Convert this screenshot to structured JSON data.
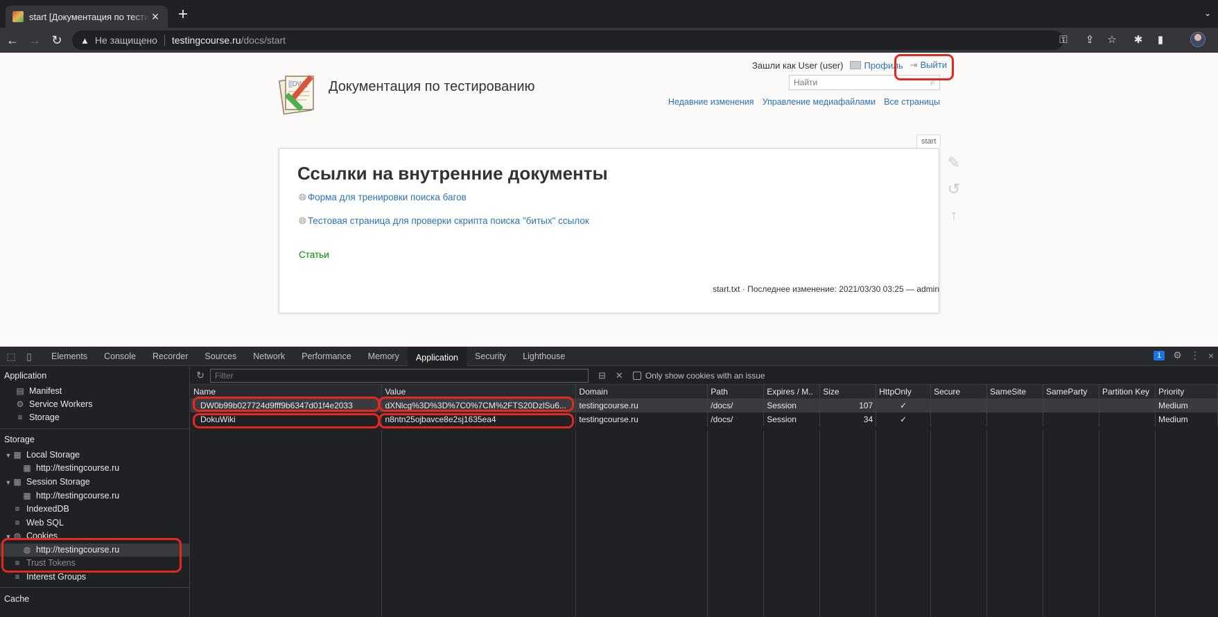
{
  "browser": {
    "tab_title": "start [Документация по тестированию]",
    "address": {
      "warning": "Не защищено",
      "host": "testingcourse.ru",
      "path": "/docs/start"
    }
  },
  "page": {
    "site_title": "Документация по тестированию",
    "logged_in_as": "Зашли как User (user)",
    "profile_link": "Профиль",
    "logout_link": "Выйти",
    "search_placeholder": "Найти",
    "links": [
      "Недавние изменения",
      "Управление медиафайлами",
      "Все страницы"
    ],
    "page_tab": "start",
    "heading": "Ссылки на внутренние документы",
    "doc_links": [
      "Форма для тренировки поиска багов",
      "Тестовая страница для проверки скрипта поиска \"битых\" ссылок"
    ],
    "articles": "Статьи",
    "page_info": "start.txt · Последнее изменение: 2021/03/30 03:25 — admin"
  },
  "devtools": {
    "tabs": [
      "Elements",
      "Console",
      "Recorder",
      "Sources",
      "Network",
      "Performance",
      "Memory",
      "Application",
      "Security",
      "Lighthouse"
    ],
    "active_tab": "Application",
    "issues_count": "1",
    "sidebar": {
      "application_head": "Application",
      "application_items": [
        "Manifest",
        "Service Workers",
        "Storage"
      ],
      "storage_head": "Storage",
      "local_storage": "Local Storage",
      "local_storage_origin": "http://testingcourse.ru",
      "session_storage": "Session Storage",
      "session_storage_origin": "http://testingcourse.ru",
      "indexeddb": "IndexedDB",
      "websql": "Web SQL",
      "cookies": "Cookies",
      "cookies_origin": "http://testingcourse.ru",
      "trust_tokens": "Trust Tokens",
      "interest_groups": "Interest Groups",
      "cache_head": "Cache"
    },
    "filter_placeholder": "Filter",
    "only_issue_label": "Only show cookies with an issue",
    "columns": [
      "Name",
      "Value",
      "Domain",
      "Path",
      "Expires / M..",
      "Size",
      "HttpOnly",
      "Secure",
      "SameSite",
      "SameParty",
      "Partition Key",
      "Priority"
    ],
    "rows": [
      [
        "DW0b99b027724d9fff9b6347d01f4e2033",
        "dXNlcg%3D%3D%7C0%7CM%2FTS20DzlSu6...",
        "testingcourse.ru",
        "/docs/",
        "Session",
        "107",
        "✓",
        "",
        "",
        "",
        "",
        "Medium"
      ],
      [
        "DokuWiki",
        "n8ntn25ojbavce8e2sj1635ea4",
        "testingcourse.ru",
        "/docs/",
        "Session",
        "34",
        "✓",
        "",
        "",
        "",
        "",
        "Medium"
      ]
    ]
  },
  "colors": {
    "annotation": "#e4281f",
    "link": "#2b73b7",
    "devtools_bg": "#202124"
  }
}
